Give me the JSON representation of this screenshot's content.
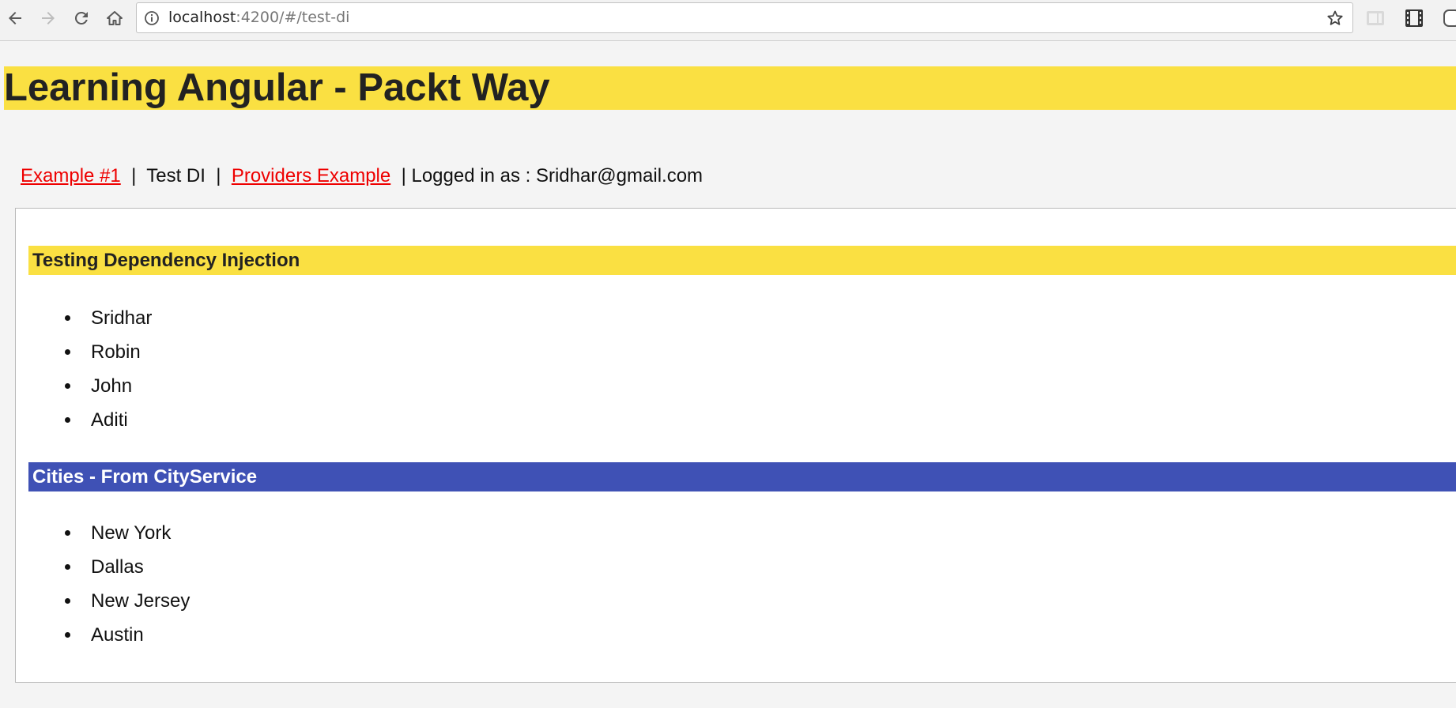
{
  "browser": {
    "url_host": "localhost",
    "url_path": ":4200/#/test-di",
    "icons": [
      "back-arrow-icon",
      "forward-arrow-icon",
      "reload-icon",
      "home-icon",
      "info-icon",
      "star-icon",
      "extension-icon",
      "film-icon",
      "extension-icon"
    ]
  },
  "app": {
    "title": "Learning Angular - Packt Way"
  },
  "nav": {
    "link1": "Example #1",
    "sep1": "  |  ",
    "current": "Test DI",
    "sep2": "  |  ",
    "link2": "Providers Example",
    "logged_in": "  | Logged in as : Sridhar@gmail.com"
  },
  "di_section": {
    "title": "Testing Dependency Injection",
    "items": [
      "Sridhar",
      "Robin",
      "John",
      "Aditi"
    ]
  },
  "cities_section": {
    "title": "Cities - From CityService",
    "items": [
      "New York",
      "Dallas",
      "New Jersey",
      "Austin"
    ]
  },
  "colors": {
    "yellow": "#fae042",
    "blue": "#3f51b5",
    "link": "#ee0000"
  }
}
